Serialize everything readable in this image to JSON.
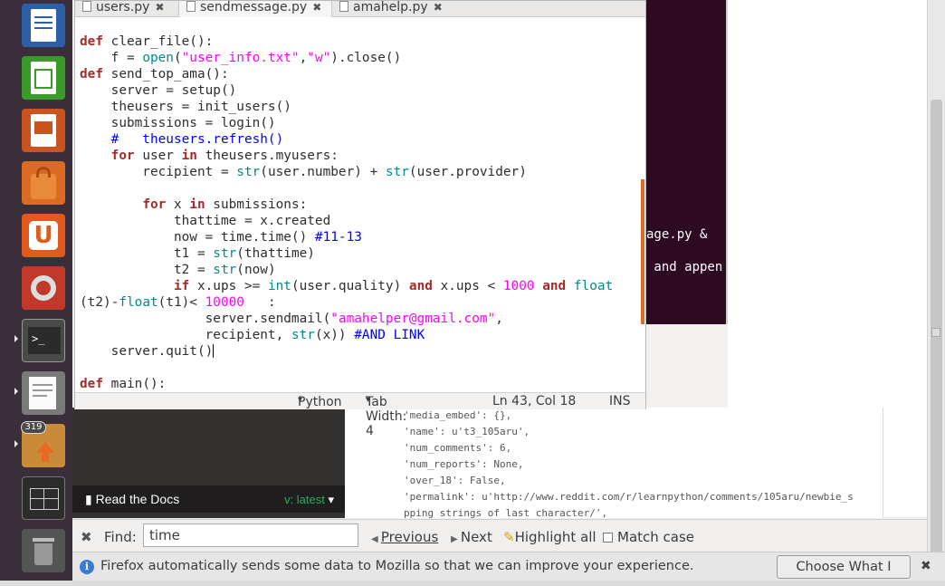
{
  "launcher": {
    "icons": [
      "writer-icon",
      "calc-icon",
      "impress-icon",
      "software-center-icon",
      "ubuntu-one-icon",
      "system-settings-icon",
      "terminal-icon",
      "text-editor-icon",
      "files-update-icon",
      "workspace-switcher-icon",
      "trash-icon"
    ],
    "update_badge": "319"
  },
  "editor": {
    "tabs": [
      {
        "label": "users.py"
      },
      {
        "label": "sendmessage.py"
      },
      {
        "label": "amahelp.py"
      }
    ],
    "status": {
      "language": "Python",
      "tab_width": "Tab Width: 4",
      "position": "Ln 43, Col 18",
      "mode": "INS"
    }
  },
  "terminal": {
    "lines": [
      "age.py &",
      " and appen"
    ]
  },
  "json_dump": {
    "lines": [
      "'media_embed': {},",
      "'name': u't3_105aru',",
      "'num_comments': 6,",
      "'num_reports': None,",
      "'over_18': False,",
      "'permalink': u'http://www.reddit.com/r/learnpython/comments/105aru/newbie_s",
      "pping strings of last character/',"
    ]
  },
  "docs": {
    "read_the_docs": "Read the Docs",
    "version": "v: latest"
  },
  "findbar": {
    "label": "Find:",
    "query": "time",
    "previous": "Previous",
    "next": "Next",
    "highlight_all": "Highlight all",
    "match_case": "Match case"
  },
  "notification": {
    "text": "Firefox automatically sends some data to Mozilla so that we can improve your experience.",
    "button": "Choose What I Share"
  },
  "colors": {
    "launcher_bg": "#3a2e3a",
    "terminal_bg": "#2d0922",
    "keyword": "#a52a2a",
    "builtin": "#008b8b",
    "string": "#ff00ff",
    "comment": "#0000ff"
  }
}
